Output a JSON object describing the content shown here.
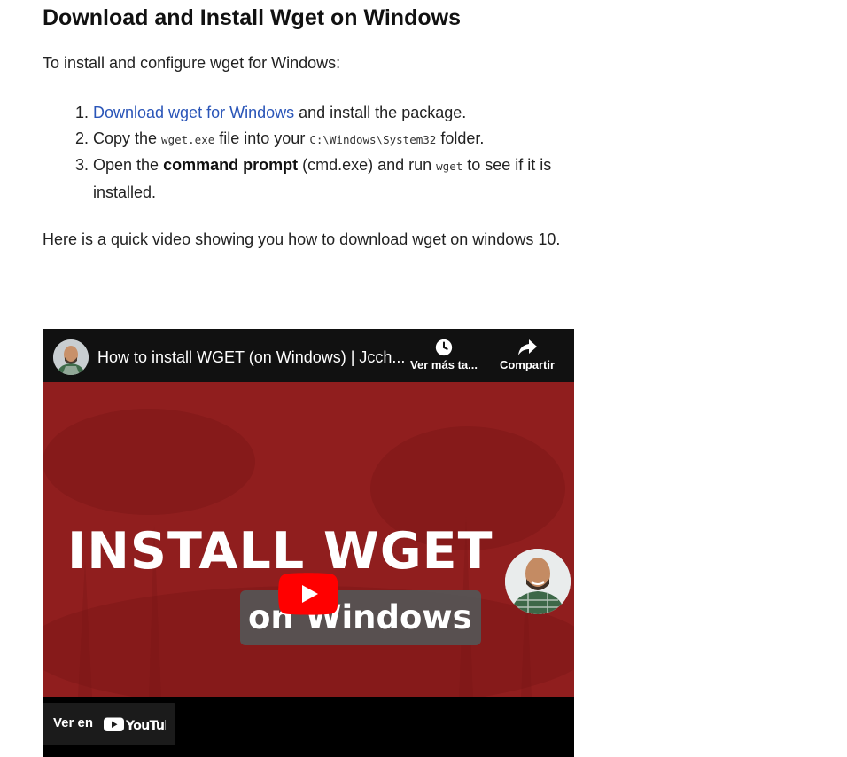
{
  "article": {
    "title": "Download and Install Wget on Windows",
    "intro": "To install and configure wget for Windows:",
    "steps": {
      "s1": {
        "link": "Download wget for Windows",
        "rest": " and install the package."
      },
      "s2": {
        "a": "Copy the ",
        "code1": "wget.exe",
        "b": " file into your ",
        "code2": "C:\\Windows\\System32",
        "c": " folder."
      },
      "s3": {
        "a": "Open the ",
        "bold": "command prompt",
        "b": " (cmd.exe) and run ",
        "code": "wget",
        "c": " to see if it is installed."
      }
    },
    "outro": "Here is a quick video showing you how to download wget on windows 10."
  },
  "video": {
    "title": "How to install WGET (on Windows) | Jcch...",
    "watch_later_label": "Ver más ta...",
    "share_label": "Compartir",
    "thumbnail_line1": "INSTALL WGET",
    "thumbnail_line2": "on Windows",
    "watch_on_label": "Ver en",
    "youtube_wordmark": "YouTube",
    "icons": {
      "avatar": "channel-avatar",
      "clock": "clock-icon",
      "share": "share-arrow-icon",
      "play": "youtube-play-icon"
    },
    "colors": {
      "thumbnail_bg": "#8d1d1d",
      "play_red": "#ff0000",
      "link": "#2a55b8"
    }
  }
}
